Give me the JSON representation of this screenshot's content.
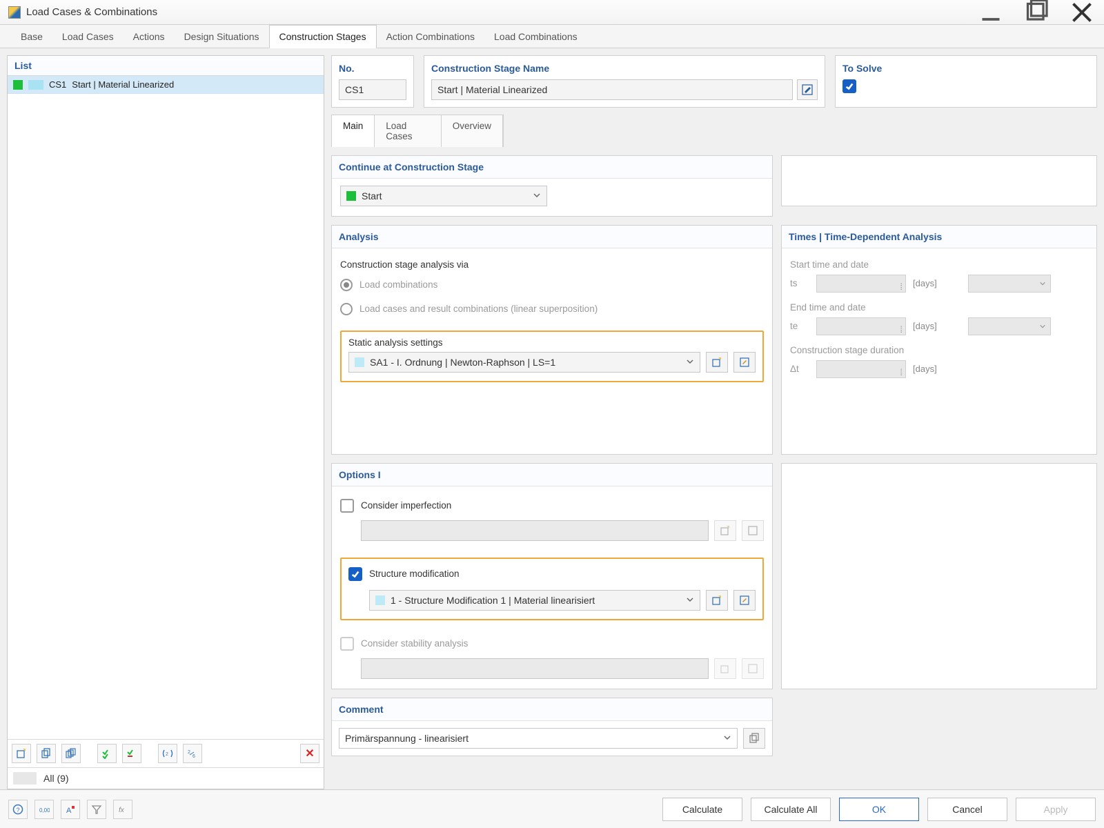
{
  "window": {
    "title": "Load Cases & Combinations"
  },
  "topTabs": {
    "items": [
      "Base",
      "Load Cases",
      "Actions",
      "Design Situations",
      "Construction Stages",
      "Action Combinations",
      "Load Combinations"
    ],
    "activeIndex": 4
  },
  "list": {
    "header": "List",
    "rows": [
      {
        "code": "CS1",
        "label": "Start | Material Linearized"
      }
    ],
    "filterLabel": "All (9)"
  },
  "header": {
    "noLabel": "No.",
    "noValue": "CS1",
    "nameLabel": "Construction Stage Name",
    "nameValue": "Start | Material Linearized",
    "toSolveLabel": "To Solve",
    "toSolveChecked": true
  },
  "subTabs": {
    "items": [
      "Main",
      "Load Cases",
      "Overview"
    ],
    "activeIndex": 0
  },
  "continueSection": {
    "title": "Continue at Construction Stage",
    "value": "Start"
  },
  "analysis": {
    "title": "Analysis",
    "viaLabel": "Construction stage analysis via",
    "opt1": "Load combinations",
    "opt2": "Load cases and result combinations (linear superposition)",
    "staticLabel": "Static analysis settings",
    "staticValue": "SA1 - I. Ordnung | Newton-Raphson | LS=1"
  },
  "times": {
    "title": "Times | Time-Dependent Analysis",
    "startLabel": "Start time and date",
    "endLabel": "End time and date",
    "durLabel": "Construction stage duration",
    "ts": "ts",
    "te": "te",
    "dt": "Δt",
    "days": "[days]"
  },
  "options": {
    "title": "Options I",
    "imperfection": "Consider imperfection",
    "structureMod": "Structure modification",
    "structureModValue": "1 - Structure Modification 1 | Material linearisiert",
    "stability": "Consider stability analysis"
  },
  "comment": {
    "title": "Comment",
    "value": "Primärspannung - linearisiert"
  },
  "buttons": {
    "calculate": "Calculate",
    "calculateAll": "Calculate All",
    "ok": "OK",
    "cancel": "Cancel",
    "apply": "Apply"
  }
}
